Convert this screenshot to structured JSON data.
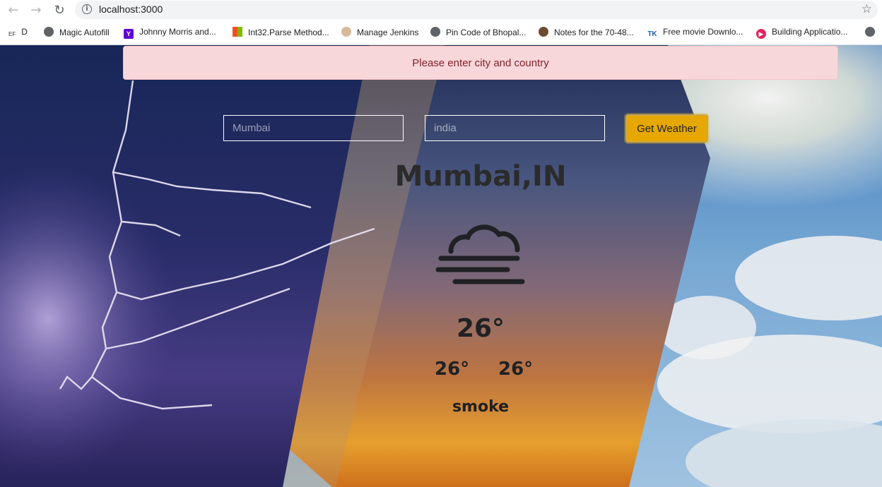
{
  "browser": {
    "url": "localhost:3000",
    "bookmarks": [
      {
        "label": "D",
        "icon": "ef-icon"
      },
      {
        "label": "Magic Autofill",
        "icon": "globe-icon"
      },
      {
        "label": "Johnny Morris and...",
        "icon": "yahoo-icon"
      },
      {
        "label": "Int32.Parse Method...",
        "icon": "microsoft-icon"
      },
      {
        "label": "Manage Jenkins",
        "icon": "jenkins-icon"
      },
      {
        "label": "Pin Code of Bhopal...",
        "icon": "globe-icon"
      },
      {
        "label": "Notes for the 70-48...",
        "icon": "person-icon"
      },
      {
        "label": "Free movie Downlo...",
        "icon": "tk-icon"
      },
      {
        "label": "Building Applicatio...",
        "icon": "play-icon"
      }
    ]
  },
  "alert": {
    "message": "Please enter city and country"
  },
  "form": {
    "city_placeholder": "Mumbai",
    "country_placeholder": "india",
    "submit_label": "Get Weather"
  },
  "weather": {
    "location": "Mumbai,IN",
    "icon": "fog-cloud-icon",
    "temperature": "26°",
    "temp_min": "26°",
    "temp_max": "26°",
    "description": "smoke"
  },
  "colors": {
    "alert_bg": "#f8d7da",
    "alert_text": "#842029",
    "button_bg": "#e6a800"
  }
}
